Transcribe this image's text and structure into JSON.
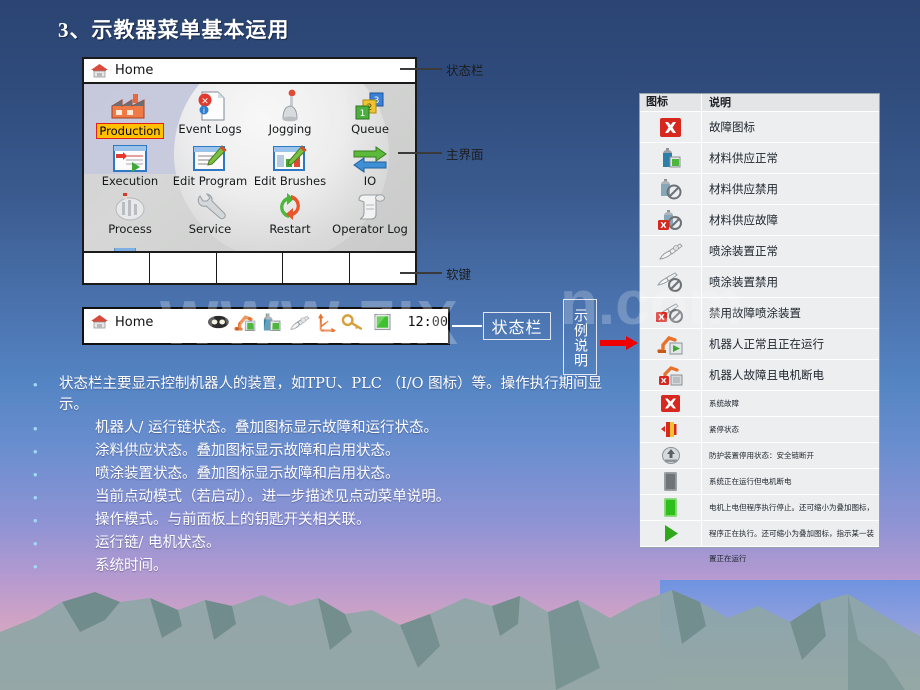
{
  "slide": {
    "title": "3、示教器菜单基本运用",
    "watermark": "WWW.ZIX",
    "watermark2": "n.com"
  },
  "pendant": {
    "home_label": "Home",
    "menu_items": [
      {
        "label": "Production",
        "icon": "factory-icon",
        "selected": true
      },
      {
        "label": "Event Logs",
        "icon": "event-log-icon",
        "selected": false
      },
      {
        "label": "Jogging",
        "icon": "joystick-icon",
        "selected": false
      },
      {
        "label": "Queue",
        "icon": "blocks-icon",
        "selected": false
      },
      {
        "label": "Execution",
        "icon": "execution-icon",
        "selected": false
      },
      {
        "label": "Edit Program",
        "icon": "edit-program-icon",
        "selected": false
      },
      {
        "label": "Edit Brushes",
        "icon": "edit-brushes-icon",
        "selected": false
      },
      {
        "label": "IO",
        "icon": "io-arrows-icon",
        "selected": false
      },
      {
        "label": "Process",
        "icon": "process-icon",
        "selected": false
      },
      {
        "label": "Service",
        "icon": "wrench-icon",
        "selected": false
      },
      {
        "label": "Restart",
        "icon": "restart-icon",
        "selected": false
      },
      {
        "label": "Operator Log",
        "icon": "scroll-icon",
        "selected": false
      }
    ],
    "softkey_count": 5
  },
  "callouts": [
    {
      "id": "status-bar",
      "label": "状态栏"
    },
    {
      "id": "main-view",
      "label": "主界面"
    },
    {
      "id": "soft-keys",
      "label": "软键"
    }
  ],
  "statusbar": {
    "home_label": "Home",
    "time": "12:00",
    "icons": [
      "tpu-plc-icon",
      "robot-status-icon",
      "paint-supply-icon",
      "sprayer-icon",
      "jog-coordinate-icon",
      "key-switch-icon",
      "motor-state-icon"
    ]
  },
  "boxed_labels": {
    "status_bar_box": "状态栏",
    "example_box": "示例说明"
  },
  "bullets": [
    {
      "text": "状态栏主要显示控制机器人的装置，如TPU、PLC （I/O 图标）等。操作执行期间显示。",
      "indent": false
    },
    {
      "text": "机器人/ 运行链状态。叠加图标显示故障和运行状态。",
      "indent": true
    },
    {
      "text": "涂料供应状态。叠加图标显示故障和启用状态。",
      "indent": true
    },
    {
      "text": "喷涂装置状态。叠加图标显示故障和启用状态。",
      "indent": true
    },
    {
      "text": "当前点动模式（若启动）。进一步描述见点动菜单说明。",
      "indent": true
    },
    {
      "text": "操作模式。与前面板上的钥匙开关相关联。",
      "indent": true
    },
    {
      "text": "运行链/ 电机状态。",
      "indent": true
    },
    {
      "text": "系统时间。",
      "indent": true
    }
  ],
  "legend": {
    "header": {
      "icon_col": "图标",
      "desc_col": "说明"
    },
    "rows_a": [
      {
        "icon": "fault-x-icon",
        "desc": "故障图标"
      },
      {
        "icon": "material-supply-ok-icon",
        "desc": "材料供应正常"
      },
      {
        "icon": "material-supply-disabled-icon",
        "desc": "材料供应禁用"
      },
      {
        "icon": "material-supply-fault-icon",
        "desc": "材料供应故障"
      },
      {
        "icon": "sprayer-ok-icon",
        "desc": "喷涂装置正常"
      },
      {
        "icon": "sprayer-disabled-icon",
        "desc": "喷涂装置禁用"
      },
      {
        "icon": "sprayer-fault-disabled-icon",
        "desc": "禁用故障喷涂装置"
      },
      {
        "icon": "robot-running-icon",
        "desc": "机器人正常且正在运行"
      },
      {
        "icon": "robot-fault-motor-off-icon",
        "desc": "机器人故障且电机断电"
      }
    ],
    "rows_b": [
      {
        "icon": "system-fault-icon",
        "desc": "系统故障"
      },
      {
        "icon": "emergency-stop-icon",
        "desc": "紧停状态"
      },
      {
        "icon": "guard-stop-icon",
        "desc": "防护装置停用状态：安全链断开"
      },
      {
        "icon": "motor-off-icon",
        "desc": "系统正在运行但电机断电"
      },
      {
        "icon": "motor-on-stopped-icon",
        "desc": "电机上电但程序执行停止。还可缩小为叠加图标，指示某一装置准备就绪"
      },
      {
        "icon": "program-running-icon",
        "desc": "程序正在执行。还可缩小为叠加图标，指示某一装置正在运行"
      }
    ]
  },
  "colors": {
    "selection_fill": "#ffc000",
    "selection_border": "#e02020",
    "arrow": "#ee0000",
    "title_text": "#ffffff"
  }
}
